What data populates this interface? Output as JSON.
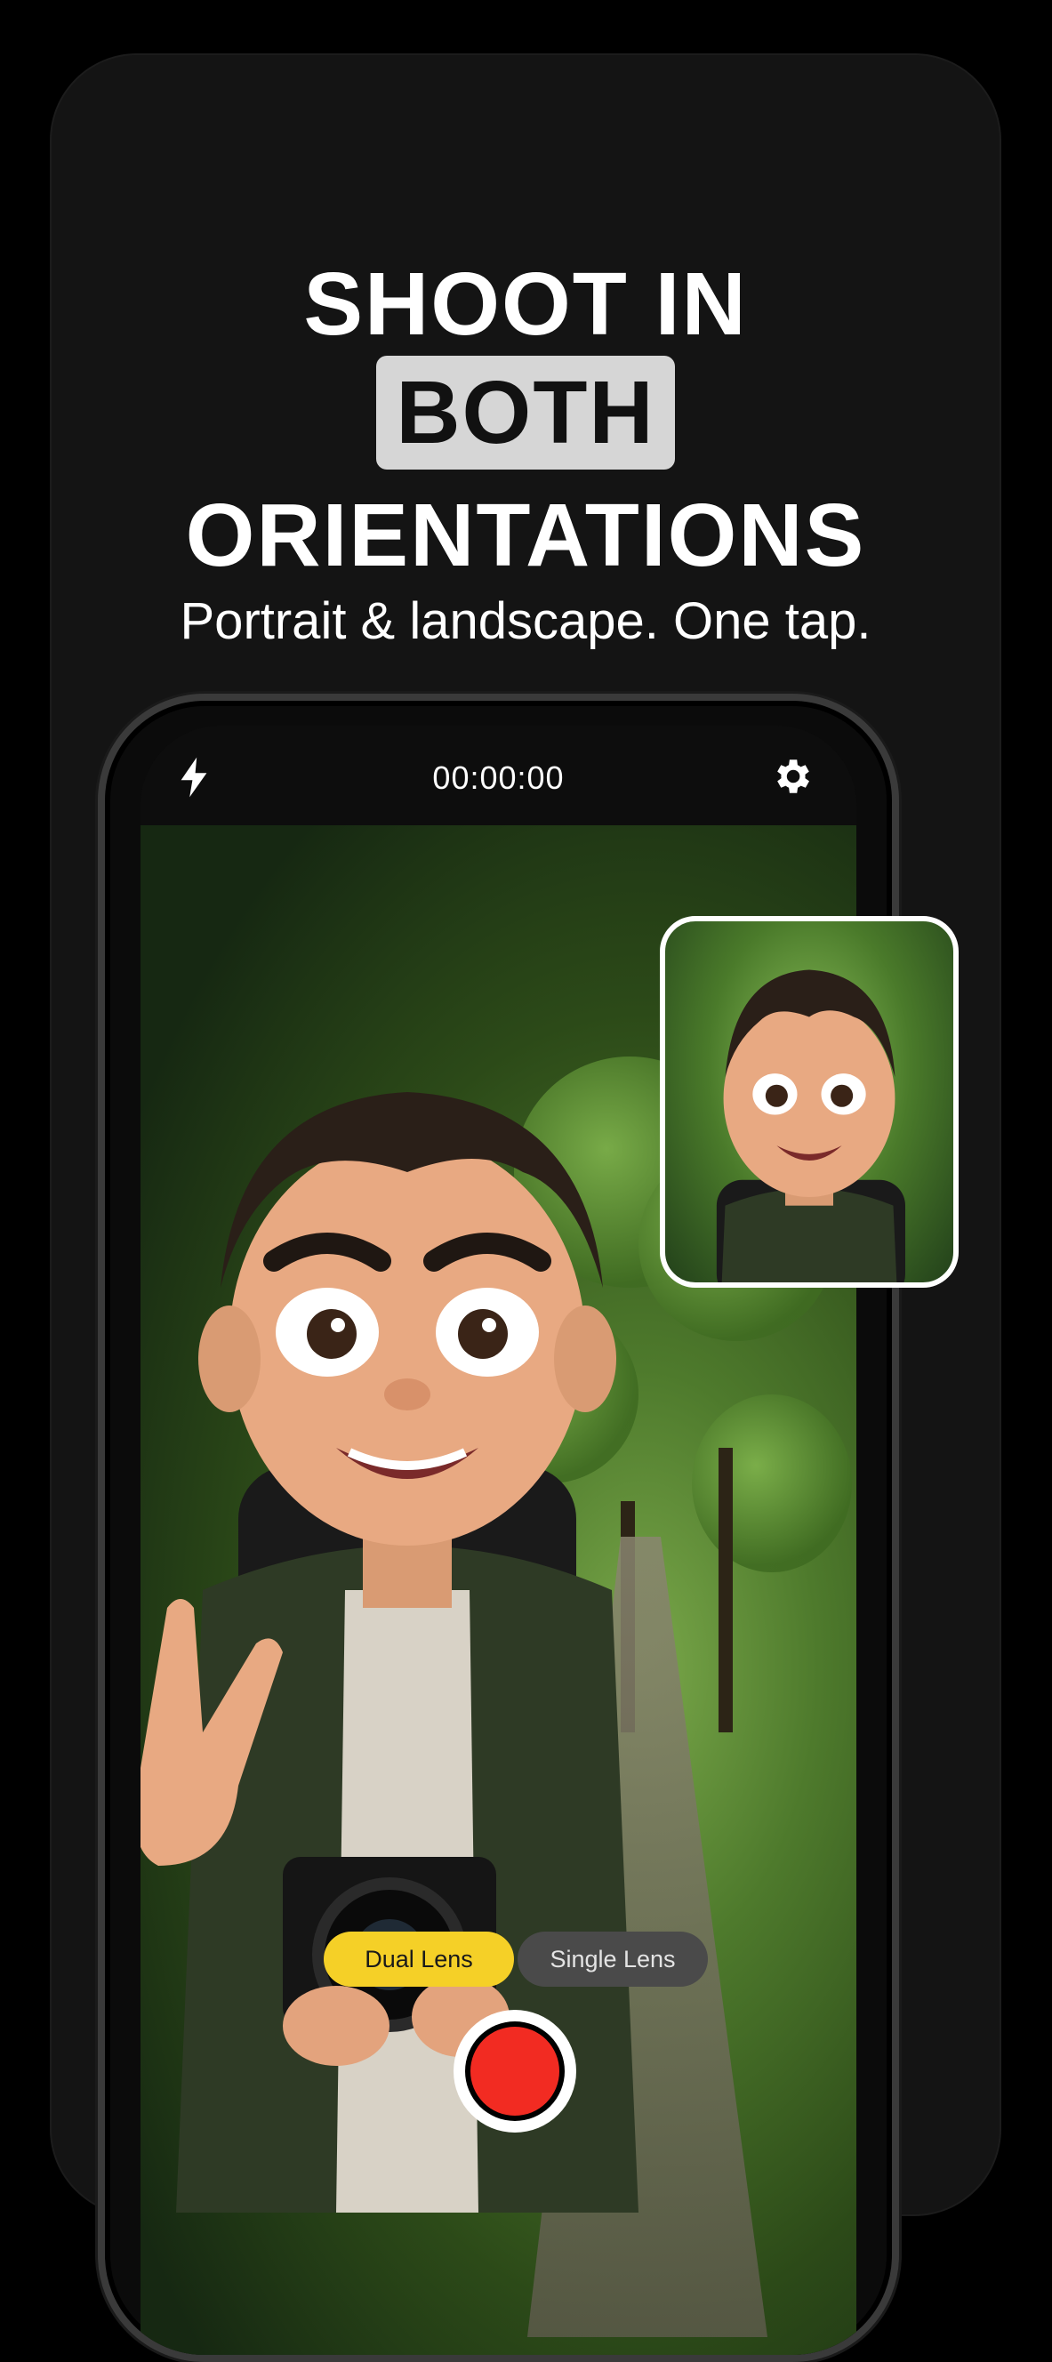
{
  "headline": {
    "line1": "SHOOT IN",
    "line2": "BOTH",
    "line3": "ORIENTATIONS",
    "subline": "Portrait & landscape. One tap."
  },
  "camera": {
    "timer": "00:00:00",
    "icons": [
      "flash-icon",
      "gear-icon"
    ],
    "modes": [
      {
        "label": "Dual Lens",
        "selected": true
      },
      {
        "label": "Single Lens",
        "selected": false
      }
    ],
    "record_color": "#f22b22",
    "accent": "#f5d027"
  }
}
